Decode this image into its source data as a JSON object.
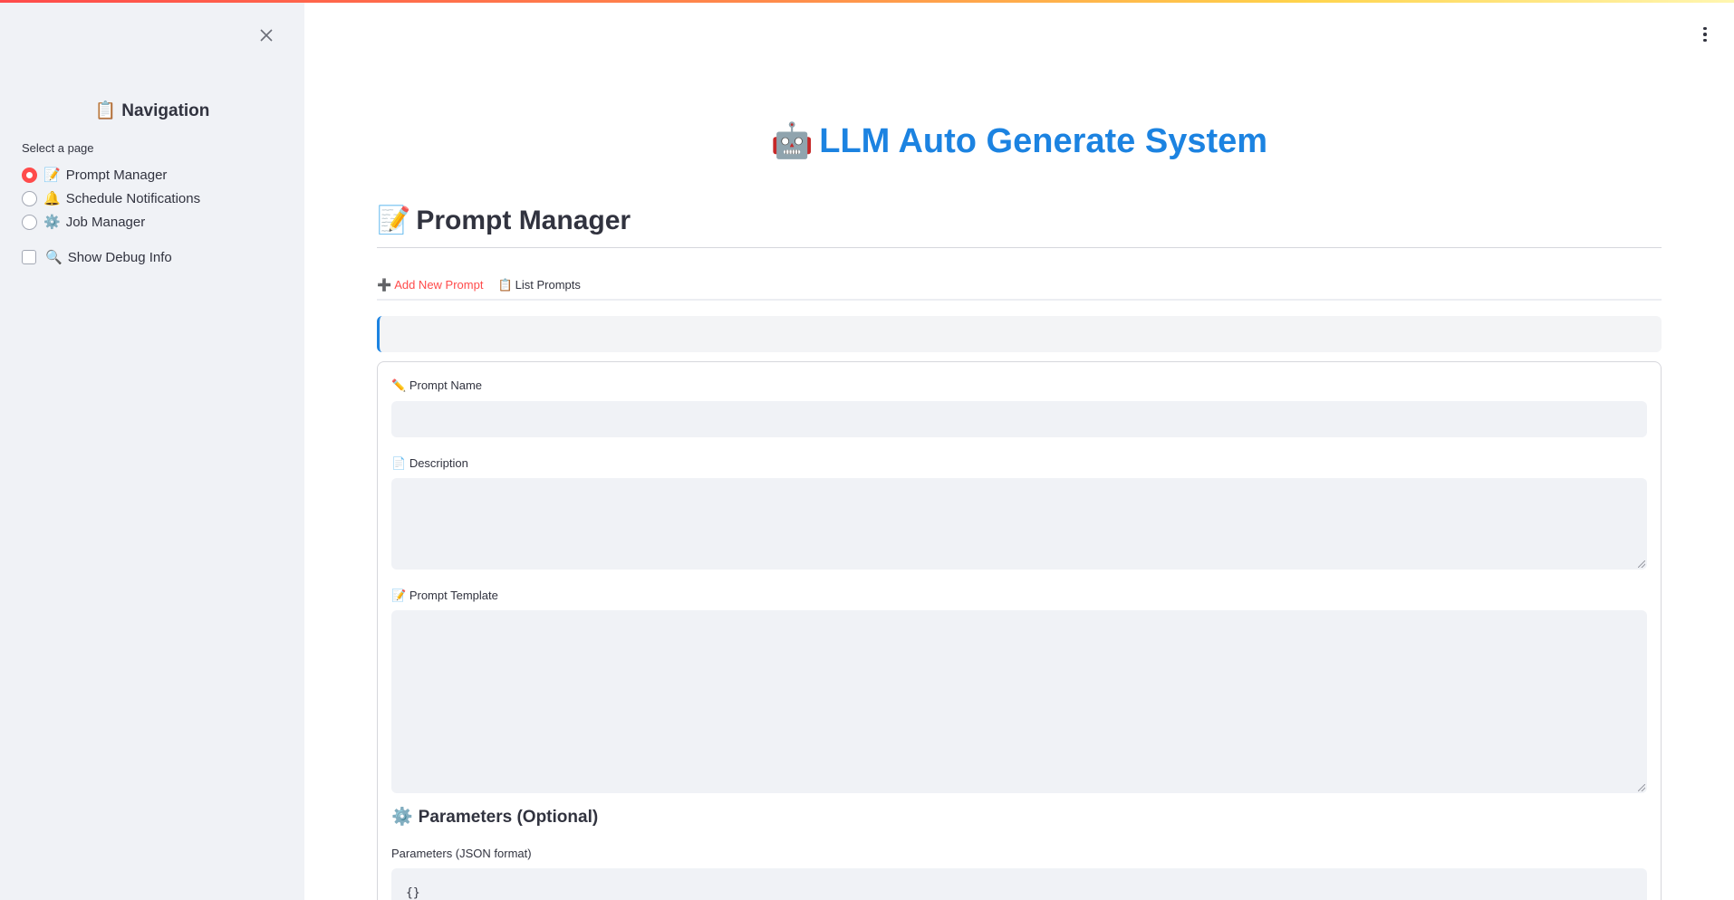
{
  "sidebar": {
    "title_icon": "📋",
    "title": "Navigation",
    "select_caption": "Select a page",
    "pages": [
      {
        "icon": "📝",
        "label": "Prompt Manager",
        "selected": true
      },
      {
        "icon": "🔔",
        "label": "Schedule Notifications",
        "selected": false
      },
      {
        "icon": "⚙️",
        "label": "Job Manager",
        "selected": false
      }
    ],
    "debug_checkbox": {
      "icon": "🔍",
      "label": "Show Debug Info",
      "checked": false
    },
    "close_icon": "close-icon"
  },
  "header": {
    "app_icon": "🤖",
    "app_title": "LLM Auto Generate System",
    "title_color": "#1c83e1"
  },
  "page": {
    "icon": "📝",
    "title": "Prompt Manager"
  },
  "tabs": [
    {
      "icon": "➕",
      "label": "Add New Prompt",
      "active": true
    },
    {
      "icon": "📋",
      "label": "List Prompts",
      "active": false
    }
  ],
  "form": {
    "prompt_name": {
      "icon": "✏️",
      "label": "Prompt Name",
      "value": ""
    },
    "description": {
      "icon": "📄",
      "label": "Description",
      "value": ""
    },
    "prompt_template": {
      "icon": "📝",
      "label": "Prompt Template",
      "value": ""
    },
    "parameters_section": {
      "icon": "⚙️",
      "title": "Parameters (Optional)"
    },
    "parameters": {
      "label": "Parameters (JSON format)",
      "value": "{}"
    }
  },
  "colors": {
    "accent": "#ff4b4b",
    "info": "#1c83e1",
    "sidebar_bg": "#f0f2f6"
  }
}
